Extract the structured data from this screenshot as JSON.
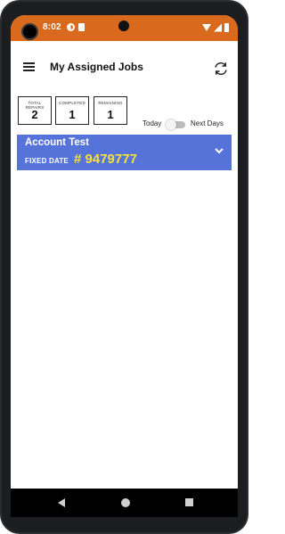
{
  "status_bar": {
    "time": "8:02",
    "background_color": "#d8691d",
    "icons": [
      "notification-icon",
      "sim-icon",
      "wifi-icon",
      "signal-icon",
      "battery-icon"
    ]
  },
  "app_bar": {
    "title": "My Assigned Jobs",
    "menu_icon": "menu-icon",
    "refresh_icon": "refresh-icon"
  },
  "stats": [
    {
      "label": "TOTAL REPAIRS",
      "value": "2"
    },
    {
      "label": "COMPLETED",
      "value": "1"
    },
    {
      "label": "REMAINING",
      "value": "1"
    }
  ],
  "filter": {
    "left_label": "Today",
    "right_label": "Next Days",
    "toggle_on": false
  },
  "job_card": {
    "title": "Account Test",
    "date_label": "FIXED DATE",
    "number": "# 9479777",
    "background_color": "#5573d8",
    "number_color": "#f7e13b",
    "expand_icon": "chevron-down-icon"
  },
  "nav_bar": {
    "icons": [
      "back-icon",
      "home-icon",
      "recents-icon"
    ]
  }
}
